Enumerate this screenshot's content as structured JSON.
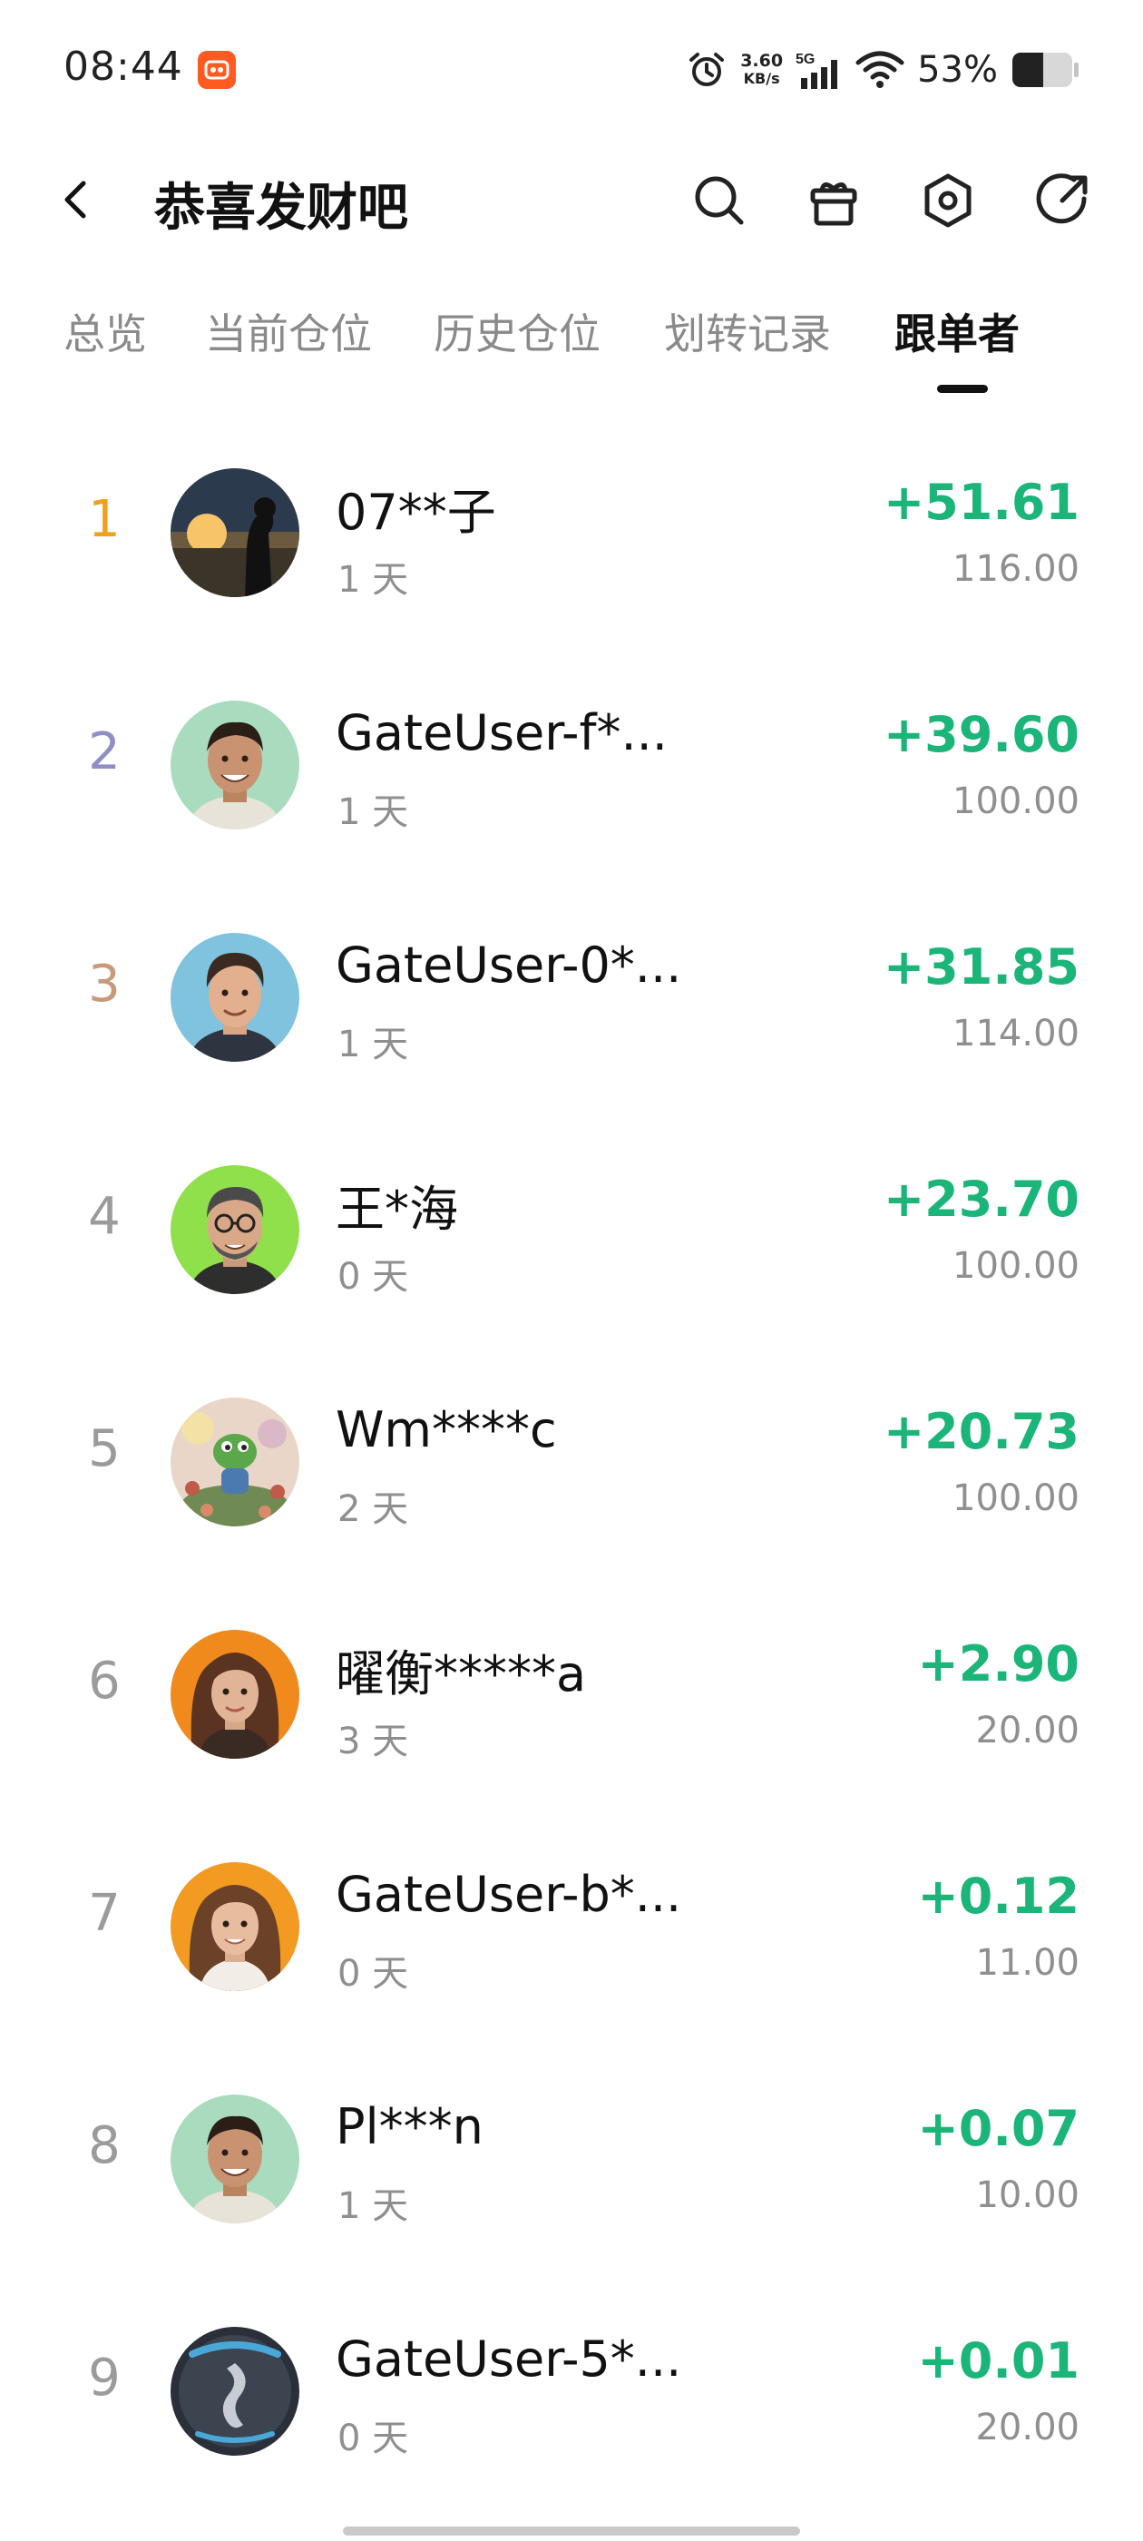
{
  "status_bar": {
    "time": "08:44",
    "net_speed_value": "3.60",
    "net_speed_unit": "KB/s",
    "network_type": "5G",
    "battery_percent": "53%",
    "icons": [
      "app-notification-icon",
      "alarm-icon",
      "signal-icon",
      "wifi-icon",
      "battery-icon"
    ]
  },
  "header": {
    "title": "恭喜发财吧",
    "icons": [
      "back-arrow-icon",
      "search-icon",
      "gift-icon",
      "settings-icon",
      "share-icon"
    ]
  },
  "tabs": [
    {
      "label": "总览",
      "active": false
    },
    {
      "label": "当前仓位",
      "active": false
    },
    {
      "label": "历史仓位",
      "active": false
    },
    {
      "label": "划转记录",
      "active": false
    },
    {
      "label": "跟单者",
      "active": true
    }
  ],
  "colors": {
    "profit_green": "#1bb57a",
    "rank_1": "#f0a020",
    "rank_2": "#8f8fc6",
    "rank_3": "#c99a7a",
    "rank_other": "#9b9b9b",
    "text_primary": "#111111",
    "text_secondary": "#8f8f8f"
  },
  "followers": [
    {
      "rank": "1",
      "name": "07**子",
      "days": "1 天",
      "profit": "+51.61",
      "amount": "116.00"
    },
    {
      "rank": "2",
      "name": "GateUser-f*...",
      "days": "1 天",
      "profit": "+39.60",
      "amount": "100.00"
    },
    {
      "rank": "3",
      "name": "GateUser-0*...",
      "days": "1 天",
      "profit": "+31.85",
      "amount": "114.00"
    },
    {
      "rank": "4",
      "name": "王*海",
      "days": "0 天",
      "profit": "+23.70",
      "amount": "100.00"
    },
    {
      "rank": "5",
      "name": "Wm****c",
      "days": "2 天",
      "profit": "+20.73",
      "amount": "100.00"
    },
    {
      "rank": "6",
      "name": "曜衡*****a",
      "days": "3 天",
      "profit": "+2.90",
      "amount": "20.00"
    },
    {
      "rank": "7",
      "name": "GateUser-b*...",
      "days": "0 天",
      "profit": "+0.12",
      "amount": "11.00"
    },
    {
      "rank": "8",
      "name": "Pl***n",
      "days": "1 天",
      "profit": "+0.07",
      "amount": "10.00"
    },
    {
      "rank": "9",
      "name": "GateUser-5*...",
      "days": "0 天",
      "profit": "+0.01",
      "amount": "20.00"
    }
  ]
}
